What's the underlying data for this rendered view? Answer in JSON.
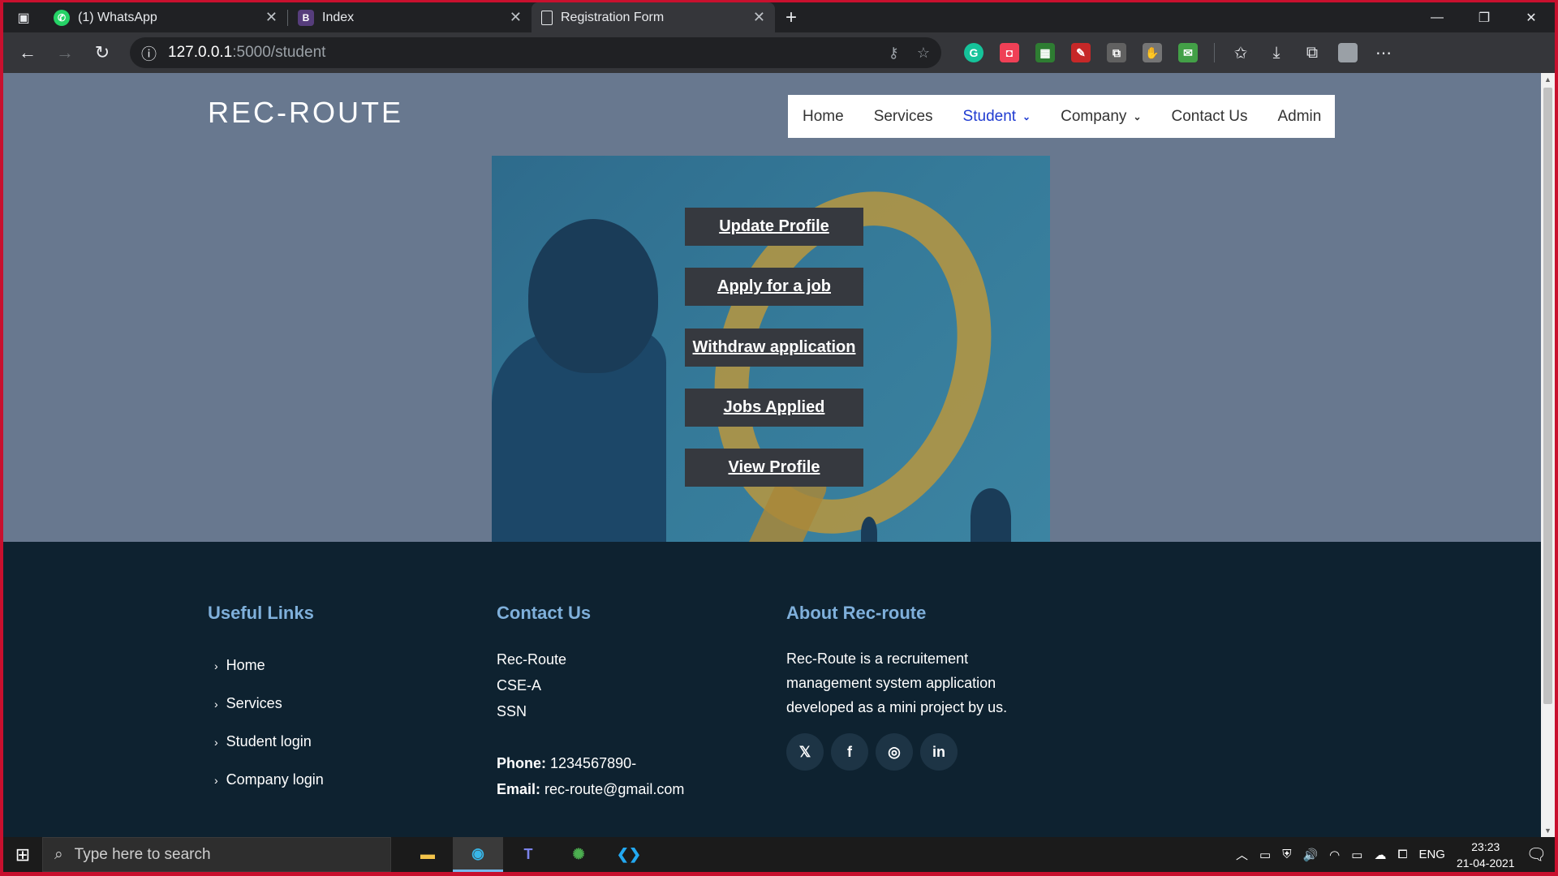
{
  "browser": {
    "tabs": [
      {
        "title": "(1) WhatsApp",
        "favicon": "whatsapp-icon",
        "active": false
      },
      {
        "title": "Index",
        "favicon": "bootstrap-icon",
        "favicon_text": "B",
        "active": false
      },
      {
        "title": "Registration Form",
        "favicon": "document-icon",
        "active": true
      }
    ],
    "url_host": "127.0.0.1",
    "url_path": ":5000/student"
  },
  "page": {
    "brand": "REC-ROUTE",
    "nav": [
      {
        "label": "Home"
      },
      {
        "label": "Services"
      },
      {
        "label": "Student",
        "active": true,
        "dropdown": true
      },
      {
        "label": "Company",
        "dropdown": true
      },
      {
        "label": "Contact Us"
      },
      {
        "label": "Admin"
      }
    ],
    "actions": [
      "Update Profile",
      "Apply for a job",
      "Withdraw application",
      "Jobs Applied",
      "View Profile"
    ],
    "footer": {
      "useful_links": {
        "heading": "Useful Links",
        "items": [
          "Home",
          "Services",
          "Student login",
          "Company login"
        ]
      },
      "contact": {
        "heading": "Contact Us",
        "lines": [
          "Rec-Route",
          "CSE-A",
          "SSN"
        ],
        "phone_label": "Phone:",
        "phone": "1234567890-",
        "email_label": "Email:",
        "email": "rec-route@gmail.com"
      },
      "about": {
        "heading": "About Rec-route",
        "text": "Rec-Route is a recruitement management system application developed as a mini project by us.",
        "socials": [
          "twitter-icon",
          "facebook-icon",
          "instagram-icon",
          "linkedin-icon"
        ]
      }
    }
  },
  "taskbar": {
    "search_placeholder": "Type here to search",
    "language": "ENG",
    "time": "23:23",
    "date": "21-04-2021"
  },
  "colors": {
    "page_bg": "#68788f",
    "footer_bg": "#0e2230",
    "footer_heading": "#7fb0db",
    "nav_active": "#1f3bd1",
    "button_bg": "#36393f",
    "frame_border": "#c8102e"
  }
}
